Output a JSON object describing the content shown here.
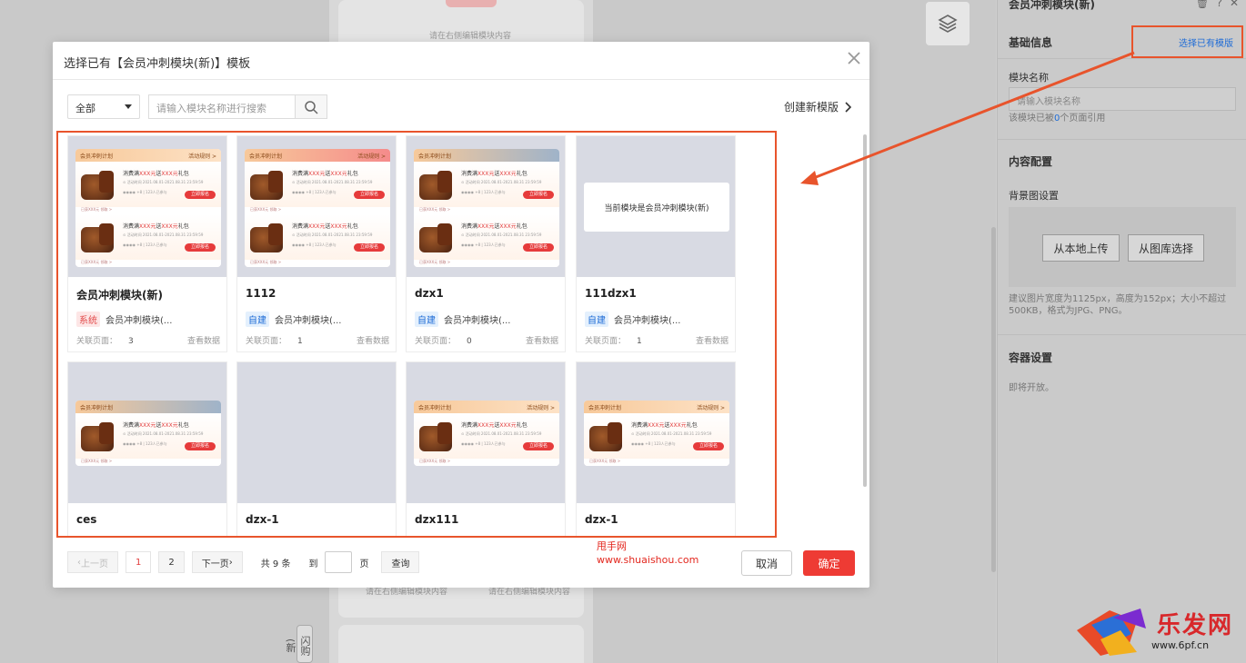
{
  "background": {
    "hint_top": "请在右侧编辑模块内容",
    "hint_bottom_left": "请在右侧编辑模块内容",
    "hint_bottom_right": "请在右侧编辑模块内容",
    "flash_label": "闪购(新"
  },
  "panel": {
    "title": "会员冲刺模块(新)",
    "basic_info": "基础信息",
    "select_existing": "选择已有模版",
    "module_name_label": "模块名称",
    "module_name_placeholder": "请输入模块名称",
    "ref_prefix": "该模块已被",
    "ref_count": "0",
    "ref_suffix": "个页面引用",
    "content_config": "内容配置",
    "bg_setting": "背景图设置",
    "upload_local": "从本地上传",
    "choose_gallery": "从图库选择",
    "bg_tip": "建议图片宽度为1125px，高度为152px；大小不超过500KB，格式为JPG、PNG。",
    "container_setting": "容器设置",
    "coming_soon": "即将开放。"
  },
  "modal": {
    "title": "选择已有【会员冲刺模块(新)】模板",
    "filter_value": "全部",
    "search_placeholder": "请输入模块名称进行搜索",
    "create_new": "创建新模版",
    "cards": [
      {
        "name": "会员冲刺模块(新)",
        "tag": "系统",
        "tag_type": "sys",
        "type_label": "会员冲刺模块(...",
        "pages_label": "关联页面：",
        "pages": "3",
        "view": "查看数据"
      },
      {
        "name": "1112",
        "tag": "自建",
        "tag_type": "own",
        "type_label": "会员冲刺模块(...",
        "pages_label": "关联页面：",
        "pages": "1",
        "view": "查看数据"
      },
      {
        "name": "dzx1",
        "tag": "自建",
        "tag_type": "own",
        "type_label": "会员冲刺模块(...",
        "pages_label": "关联页面：",
        "pages": "0",
        "view": "查看数据"
      },
      {
        "name": "111dzx1",
        "tag": "自建",
        "tag_type": "own",
        "type_label": "会员冲刺模块(...",
        "pages_label": "关联页面：",
        "pages": "1",
        "view": "查看数据"
      },
      {
        "name": "ces"
      },
      {
        "name": "dzx-1"
      },
      {
        "name": "dzx111"
      },
      {
        "name": "dzx-1"
      }
    ],
    "current_module_text": "当前模块是会员冲刺模块(新)",
    "thumb": {
      "bar_title": "会员冲刺计划",
      "bar_right": "活动规则 >",
      "line1_a": "消费满",
      "line1_b": "XXX元",
      "line1_c": "送",
      "line1_d": "XXX元",
      "line1_e": "礼包",
      "line2": "⊙ 活动时间 2021.08.01-2021.08.31 23:59:59",
      "line3": "◉◉◉◉ +8 | 123人已参与",
      "go": "立即报名",
      "sep": "已获XXX元 领取  >"
    },
    "pager": {
      "prev": "上一页",
      "page1": "1",
      "page2": "2",
      "next": "下一页",
      "total": "共 9 条",
      "goto": "到",
      "page_unit": "页",
      "query": "查询"
    },
    "cancel": "取消",
    "confirm": "确定"
  },
  "watermark": {
    "line1": "甩手网",
    "line2": "www.shuaishou.com"
  },
  "logo": {
    "text": "乐发网",
    "url": "www.6pf.cn"
  },
  "colors": {
    "accent_red": "#ee3b34",
    "annotation_orange": "#e8542c",
    "link_blue": "#1d6bd6"
  }
}
